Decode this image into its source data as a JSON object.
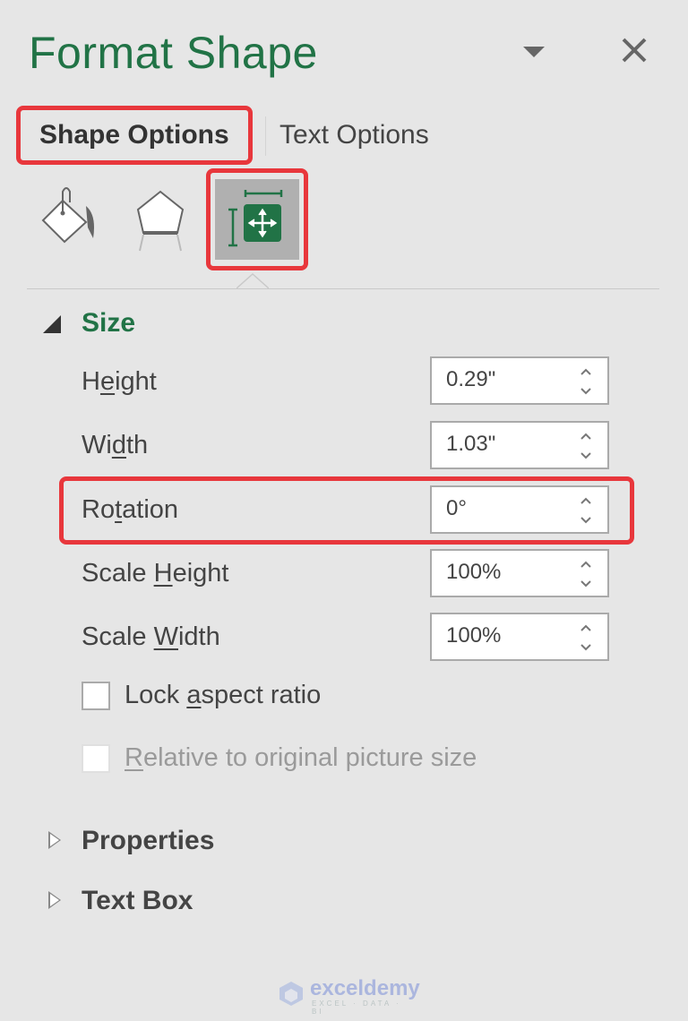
{
  "pane": {
    "title": "Format Shape",
    "menu_icon": "dropdown-arrow-icon",
    "close_icon": "close-icon"
  },
  "tabs": [
    {
      "label": "Shape Options",
      "active": true
    },
    {
      "label": "Text Options",
      "active": false
    }
  ],
  "icon_tabs": [
    {
      "name": "fill-line-icon",
      "active": false
    },
    {
      "name": "effects-icon",
      "active": false
    },
    {
      "name": "size-properties-icon",
      "active": true
    }
  ],
  "sections": {
    "size": {
      "label": "Size",
      "expanded": true,
      "fields": [
        {
          "label_pre": "H",
          "label_u": "e",
          "label_post": "ight",
          "value": "0.29\""
        },
        {
          "label_pre": "Wi",
          "label_u": "d",
          "label_post": "th",
          "value": "1.03\""
        },
        {
          "label_pre": "Ro",
          "label_u": "t",
          "label_post": "ation",
          "value": "0°"
        },
        {
          "label_pre": "Scale ",
          "label_u": "H",
          "label_post": "eight",
          "value": "100%"
        },
        {
          "label_pre": "Scale ",
          "label_u": "W",
          "label_post": "idth",
          "value": "100%"
        }
      ],
      "checkboxes": [
        {
          "label_pre": "Lock ",
          "label_u": "a",
          "label_post": "spect ratio",
          "checked": false,
          "enabled": true
        },
        {
          "label_pre": "",
          "label_u": "R",
          "label_post": "elative to original picture size",
          "checked": false,
          "enabled": false
        }
      ]
    },
    "properties": {
      "label": "Properties",
      "expanded": false
    },
    "text_box": {
      "label": "Text Box",
      "expanded": false
    }
  },
  "watermark": {
    "brand": "exceldemy",
    "tagline": "EXCEL · DATA · BI"
  },
  "colors": {
    "accent": "#217346",
    "highlight": "#e8373c"
  }
}
